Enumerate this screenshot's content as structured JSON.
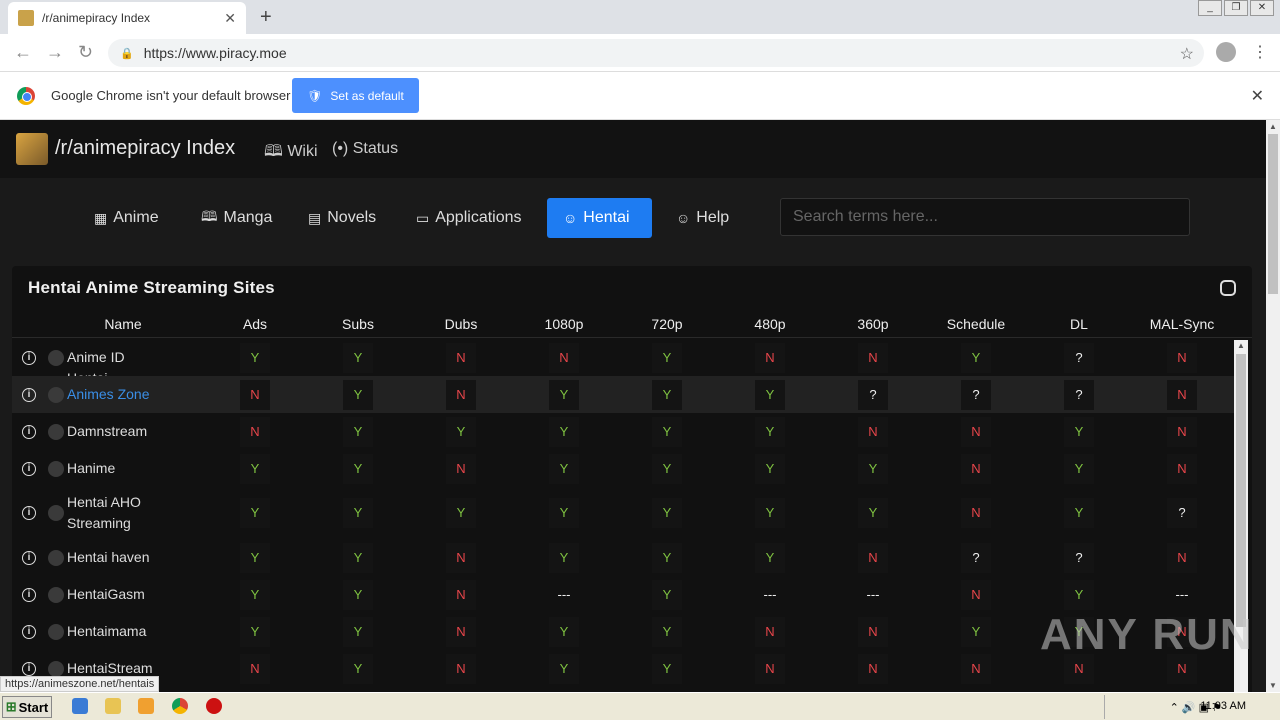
{
  "browser": {
    "tab_title": "/r/animepiracy Index",
    "url": "https://www.piracy.moe",
    "infobar_text": "Google Chrome isn't your default browser",
    "set_default_label": "Set as default"
  },
  "site": {
    "brand": "/r/animepiracy Index",
    "wiki": "Wiki",
    "status": "Status",
    "categories": [
      "Anime",
      "Manga",
      "Novels",
      "Applications",
      "Hentai",
      "Help"
    ],
    "active_category": "Hentai",
    "search_placeholder": "Search terms here..."
  },
  "table": {
    "title": "Hentai Anime Streaming Sites",
    "columns": [
      "Name",
      "Ads",
      "Subs",
      "Dubs",
      "1080p",
      "720p",
      "480p",
      "360p",
      "Schedule",
      "DL",
      "MAL-Sync"
    ],
    "rows": [
      {
        "name": "Anime ID Hentai",
        "values": [
          "Y",
          "Y",
          "N",
          "N",
          "Y",
          "N",
          "N",
          "Y",
          "?",
          "N"
        ]
      },
      {
        "name": "Animes Zone",
        "link": true,
        "values": [
          "N",
          "Y",
          "N",
          "Y",
          "Y",
          "Y",
          "?",
          "?",
          "?",
          "N"
        ]
      },
      {
        "name": "Damnstream",
        "values": [
          "N",
          "Y",
          "Y",
          "Y",
          "Y",
          "Y",
          "N",
          "N",
          "Y",
          "N"
        ]
      },
      {
        "name": "Hanime",
        "values": [
          "Y",
          "Y",
          "N",
          "Y",
          "Y",
          "Y",
          "Y",
          "N",
          "Y",
          "N"
        ]
      },
      {
        "name": "Hentai AHO Streaming",
        "values": [
          "Y",
          "Y",
          "Y",
          "Y",
          "Y",
          "Y",
          "Y",
          "N",
          "Y",
          "?"
        ]
      },
      {
        "name": "Hentai haven",
        "values": [
          "Y",
          "Y",
          "N",
          "Y",
          "Y",
          "Y",
          "N",
          "?",
          "?",
          "N"
        ]
      },
      {
        "name": "HentaiGasm",
        "values": [
          "Y",
          "Y",
          "N",
          "---",
          "Y",
          "---",
          "---",
          "N",
          "Y",
          "---"
        ]
      },
      {
        "name": "Hentaimama",
        "values": [
          "Y",
          "Y",
          "N",
          "Y",
          "Y",
          "N",
          "N",
          "Y",
          "Y",
          "N"
        ]
      },
      {
        "name": "HentaiStream",
        "values": [
          "N",
          "Y",
          "N",
          "Y",
          "Y",
          "N",
          "N",
          "N",
          "N",
          "N"
        ]
      }
    ]
  },
  "status_url": "https://animeszone.net/hentais",
  "taskbar": {
    "start": "Start",
    "time": "11:03 AM"
  },
  "watermark": "ANY RUN"
}
